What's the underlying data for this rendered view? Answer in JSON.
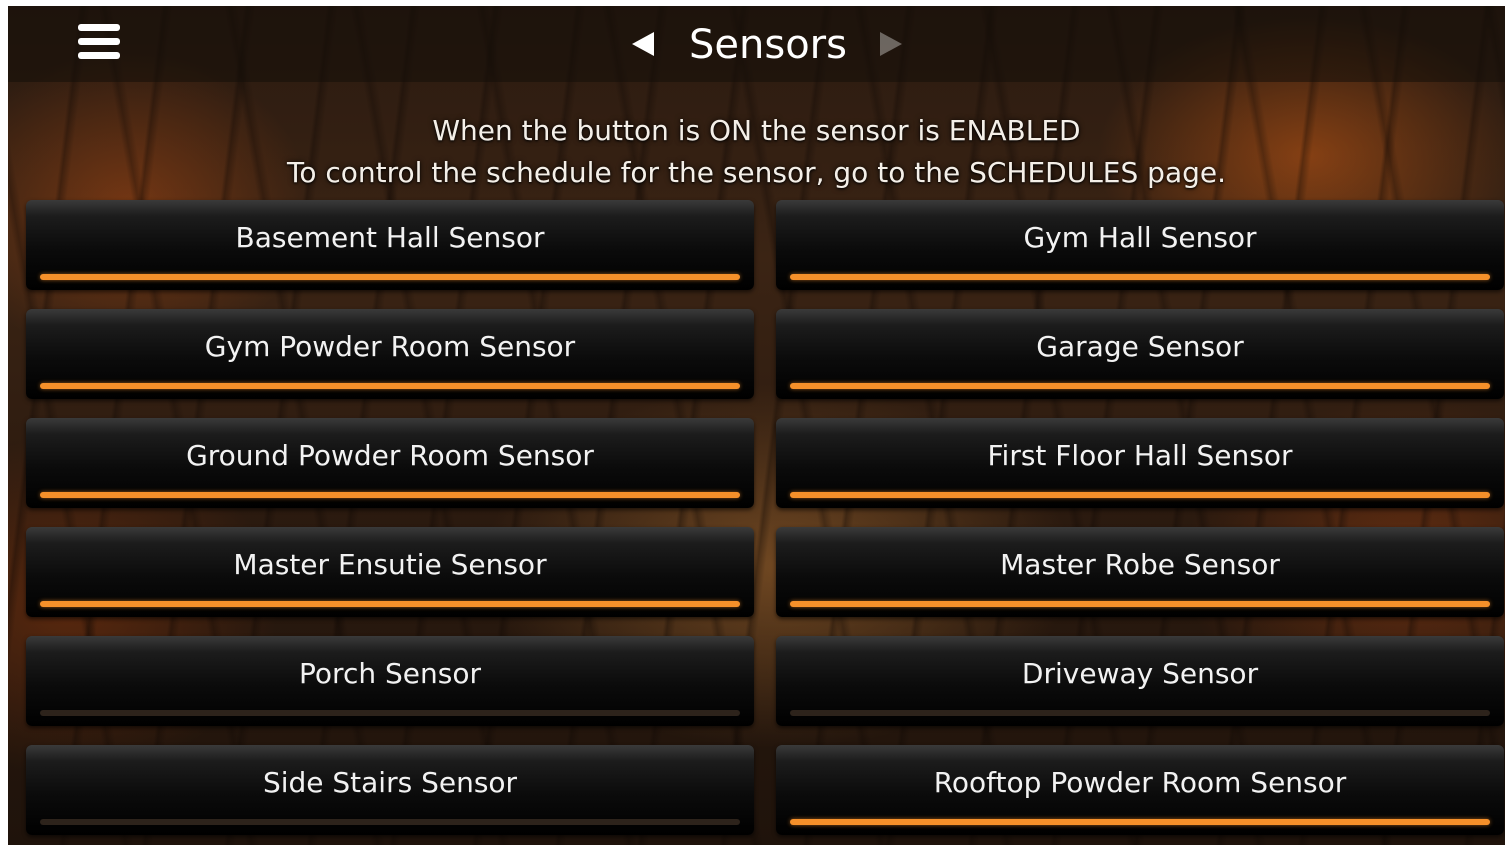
{
  "header": {
    "title": "Sensors"
  },
  "info": {
    "line1": "When the button is ON the sensor is ENABLED",
    "line2": "To control the schedule for the sensor, go to the SCHEDULES page."
  },
  "colors": {
    "on_indicator": "#f5902a",
    "off_indicator": "#2d231b"
  },
  "sensors": [
    {
      "label": "Basement Hall Sensor",
      "on": true
    },
    {
      "label": "Gym Hall Sensor",
      "on": true
    },
    {
      "label": "Gym Powder Room Sensor",
      "on": true
    },
    {
      "label": "Garage Sensor",
      "on": true
    },
    {
      "label": "Ground Powder Room Sensor",
      "on": true
    },
    {
      "label": "First Floor Hall Sensor",
      "on": true
    },
    {
      "label": "Master Ensutie Sensor",
      "on": true
    },
    {
      "label": "Master Robe Sensor",
      "on": true
    },
    {
      "label": "Porch Sensor",
      "on": false
    },
    {
      "label": "Driveway Sensor",
      "on": false
    },
    {
      "label": "Side Stairs Sensor",
      "on": false
    },
    {
      "label": "Rooftop Powder Room Sensor",
      "on": true
    }
  ]
}
